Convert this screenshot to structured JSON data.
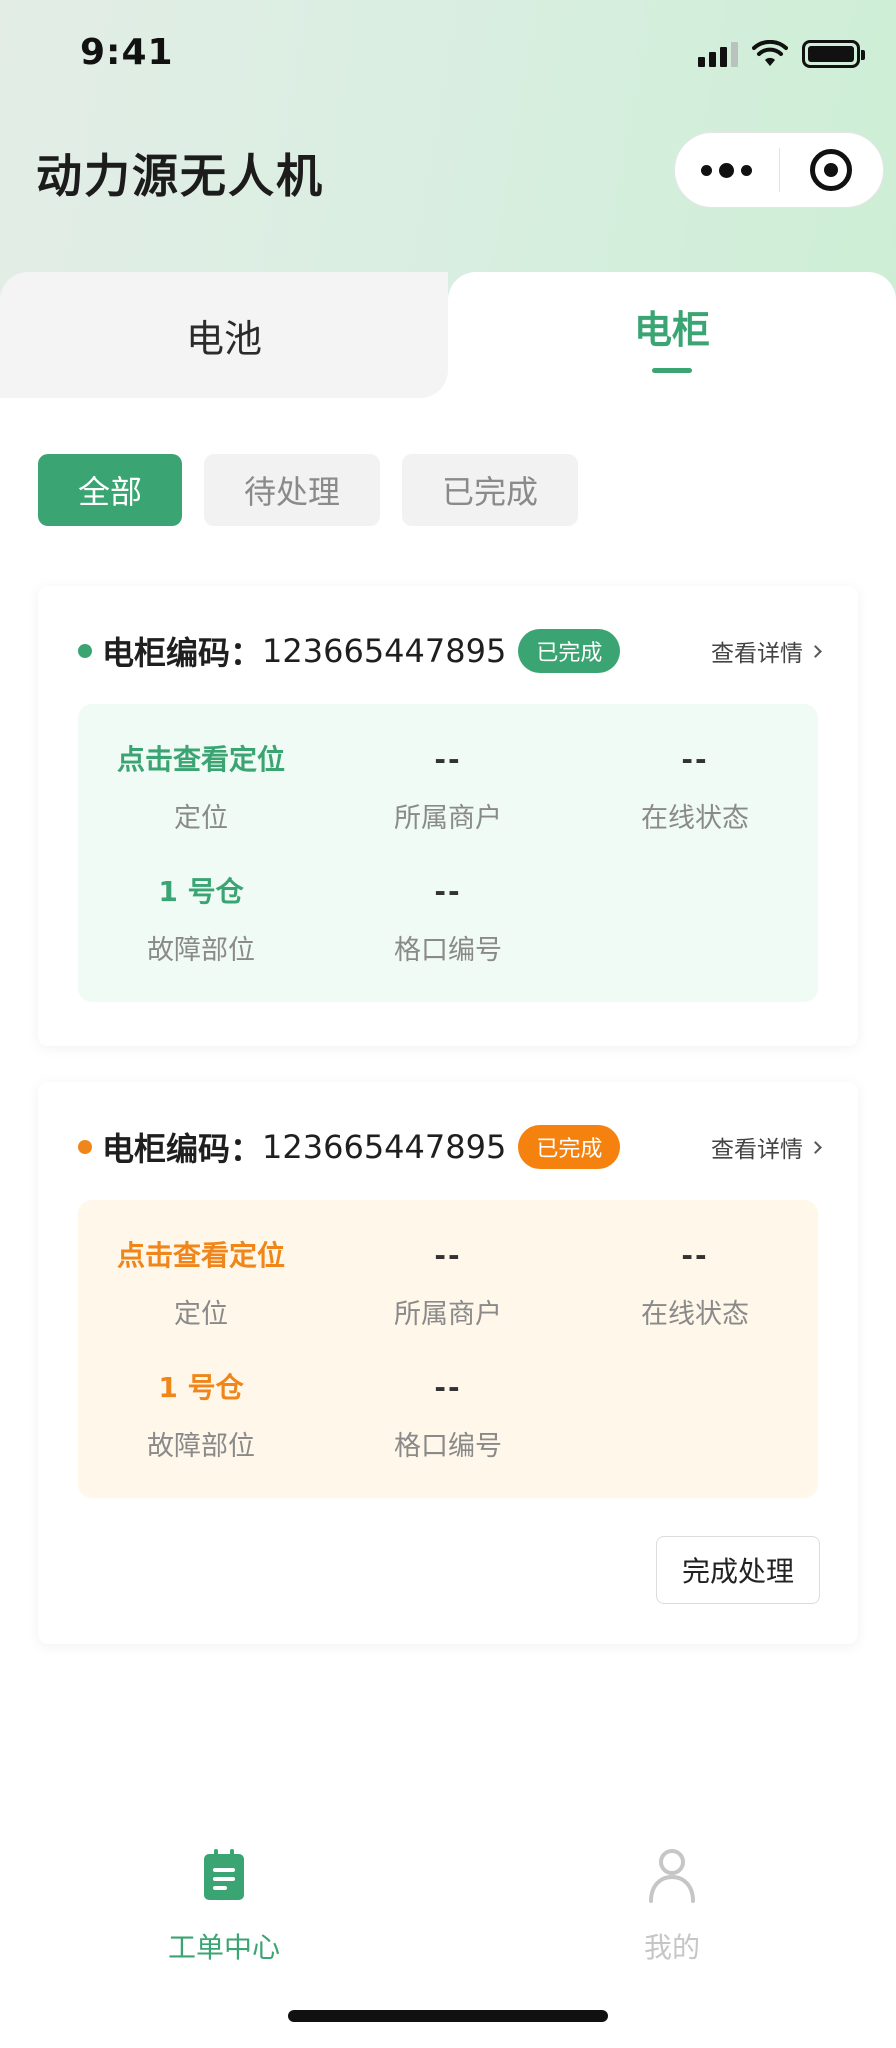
{
  "status_bar": {
    "time": "9:41"
  },
  "app": {
    "title": "动力源无人机"
  },
  "tabs": [
    {
      "label": "电池",
      "active": false
    },
    {
      "label": "电柜",
      "active": true
    }
  ],
  "filters": [
    {
      "label": "全部",
      "active": true
    },
    {
      "label": "待处理",
      "active": false
    },
    {
      "label": "已完成",
      "active": false
    }
  ],
  "cards": [
    {
      "accent": "#3aa572",
      "code_label": "电柜编码：",
      "code_value": "123665447895",
      "badge": "已完成",
      "detail_link": "查看详情",
      "fields": [
        {
          "value": "点击查看定位",
          "label": "定位"
        },
        {
          "value": "--",
          "label": "所属商户"
        },
        {
          "value": "--",
          "label": "在线状态"
        },
        {
          "value": "1 号仓",
          "label": "故障部位"
        },
        {
          "value": "--",
          "label": "格口编号"
        }
      ]
    },
    {
      "accent": "#f08519",
      "code_label": "电柜编码：",
      "code_value": "123665447895",
      "badge": "已完成",
      "detail_link": "查看详情",
      "fields": [
        {
          "value": "点击查看定位",
          "label": "定位"
        },
        {
          "value": "--",
          "label": "所属商户"
        },
        {
          "value": "--",
          "label": "在线状态"
        },
        {
          "value": "1 号仓",
          "label": "故障部位"
        },
        {
          "value": "--",
          "label": "格口编号"
        }
      ],
      "action_button": "完成处理"
    }
  ],
  "tabbar": [
    {
      "label": "工单中心",
      "icon": "clipboard-icon",
      "active": true
    },
    {
      "label": "我的",
      "icon": "person-icon",
      "active": false
    }
  ],
  "colors": {
    "primary": "#3aa572",
    "warning": "#f08519"
  }
}
